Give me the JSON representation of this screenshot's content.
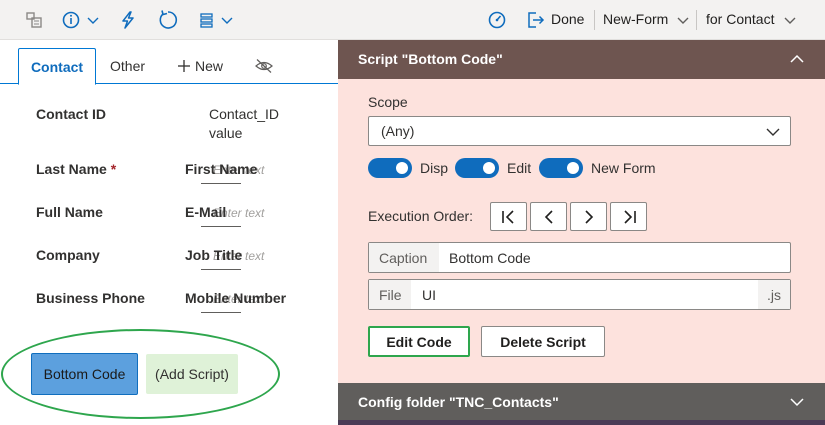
{
  "toolbar": {
    "done_label": "Done",
    "form_label": "New-Form",
    "context_label": "for Contact"
  },
  "tabs": [
    {
      "label": "Contact",
      "active": true
    },
    {
      "label": "Other"
    },
    {
      "label": "New"
    }
  ],
  "form": {
    "fields": [
      {
        "label": "Contact ID",
        "value": "Contact_ID value"
      },
      {
        "label": "Last Name",
        "required": "*",
        "label2": "First Name",
        "hint": "Enter text"
      },
      {
        "label": "Full Name",
        "label2": "E-Mail",
        "hint": "Enter text"
      },
      {
        "label": "Company",
        "label2": "Job Title",
        "hint": "Enter text"
      },
      {
        "label": "Business Phone",
        "label2": "Mobile Number",
        "hint": "Enter text"
      }
    ],
    "bottom_button": "Bottom Code",
    "add_script_button": "(Add Script)"
  },
  "script_panel": {
    "title": "Script \"Bottom Code\"",
    "scope_label": "Scope",
    "scope_value": "(Any)",
    "toggles": [
      {
        "label": "Disp",
        "on": true
      },
      {
        "label": "Edit",
        "on": true
      },
      {
        "label": "New Form",
        "on": true
      }
    ],
    "execution_order_label": "Execution Order:",
    "caption_prefix": "Caption",
    "caption_value": "Bottom Code",
    "file_prefix": "File",
    "file_value": "UI",
    "file_suffix": ".js",
    "edit_button": "Edit Code",
    "delete_button": "Delete Script"
  },
  "config_panel": {
    "title": "Config folder \"TNC_Contacts\""
  },
  "colors": {
    "accent": "#0f6cbd",
    "script_panel_bg": "#fde2dd",
    "script_header_bg": "#6e5550",
    "highlight_green": "#2ea64d"
  }
}
